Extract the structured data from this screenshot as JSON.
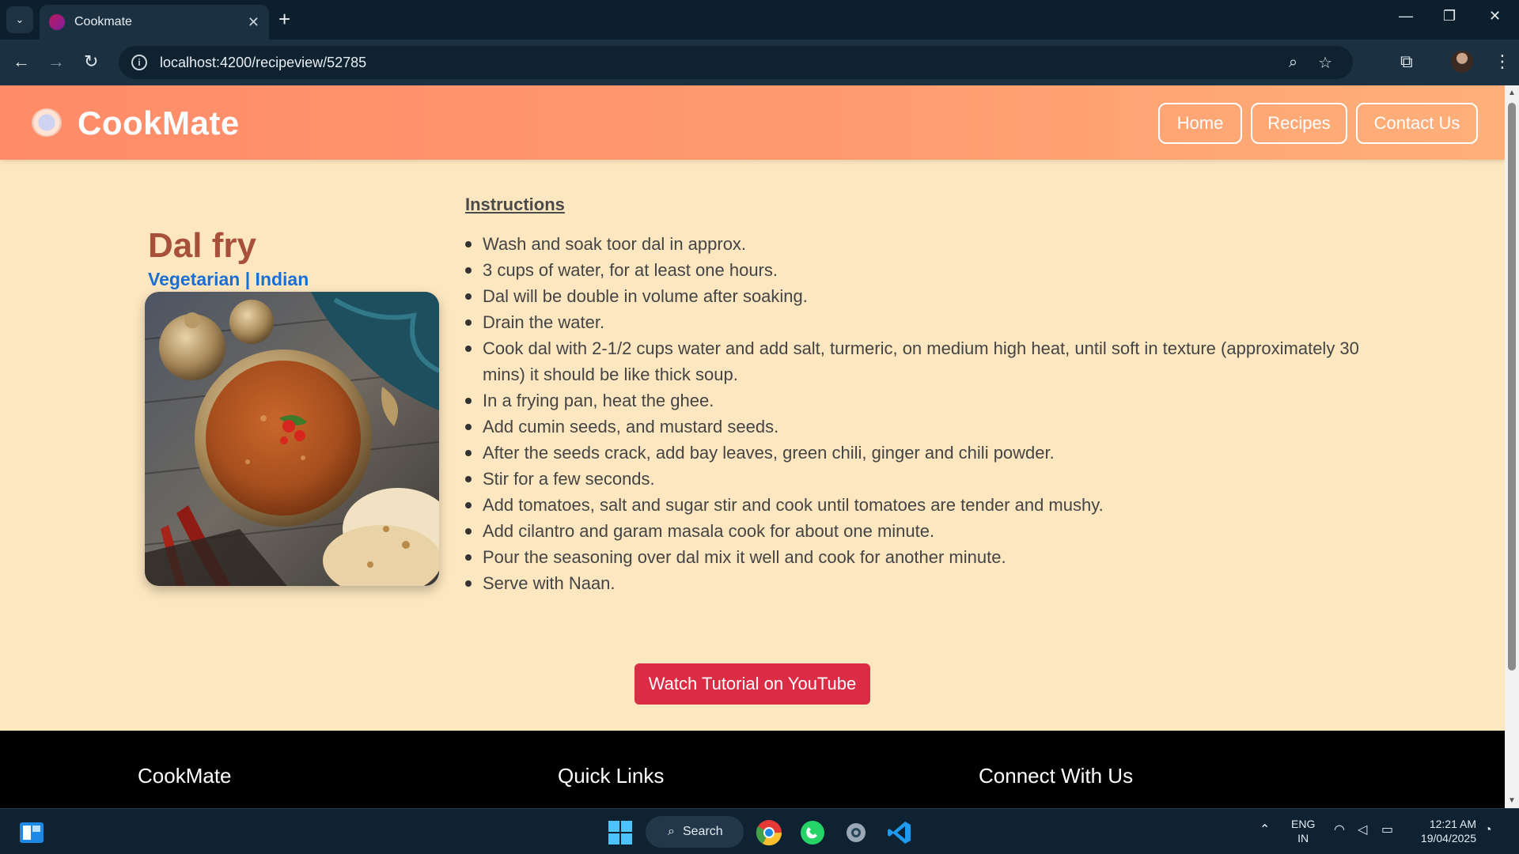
{
  "browser": {
    "tab_title": "Cookmate",
    "url": "localhost:4200/recipeview/52785",
    "tab_close": "✕",
    "new_tab": "+",
    "window_controls": {
      "minimize": "—",
      "restore": "❐",
      "close": "✕"
    }
  },
  "site": {
    "brand": "CookMate",
    "nav": [
      "Home",
      "Recipes",
      "Contact Us"
    ]
  },
  "recipe": {
    "title": "Dal fry",
    "tags": "Vegetarian | Indian",
    "instructions_heading": "Instructions",
    "steps": [
      "Wash and soak toor dal in approx.",
      "3 cups of water, for at least one hours.",
      "Dal will be double in volume after soaking.",
      "Drain the water.",
      "Cook dal with 2-1/2 cups water and add salt, turmeric, on medium high heat, until soft in texture (approximately 30 mins) it should be like thick soup.",
      "In a frying pan, heat the ghee.",
      "Add cumin seeds, and mustard seeds.",
      "After the seeds crack, add bay leaves, green chili, ginger and chili powder.",
      "Stir for a few seconds.",
      "Add tomatoes, salt and sugar stir and cook until tomatoes are tender and mushy.",
      "Add cilantro and garam masala cook for about one minute.",
      "Pour the seasoning over dal mix it well and cook for another minute.",
      "Serve with Naan."
    ],
    "youtube_button": "Watch Tutorial on YouTube"
  },
  "footer": {
    "col1": "CookMate",
    "col2": "Quick Links",
    "col3": "Connect With Us"
  },
  "taskbar": {
    "search_label": "Search",
    "lang_line1": "ENG",
    "lang_line2": "IN",
    "time": "12:21 AM",
    "date": "19/04/2025"
  },
  "colors": {
    "header_gradient_start": "#ff8b69",
    "page_background": "#fde7c0",
    "title_color": "#a7513a",
    "tag_color": "#1a6fd6",
    "youtube_button": "#dc2b45"
  }
}
